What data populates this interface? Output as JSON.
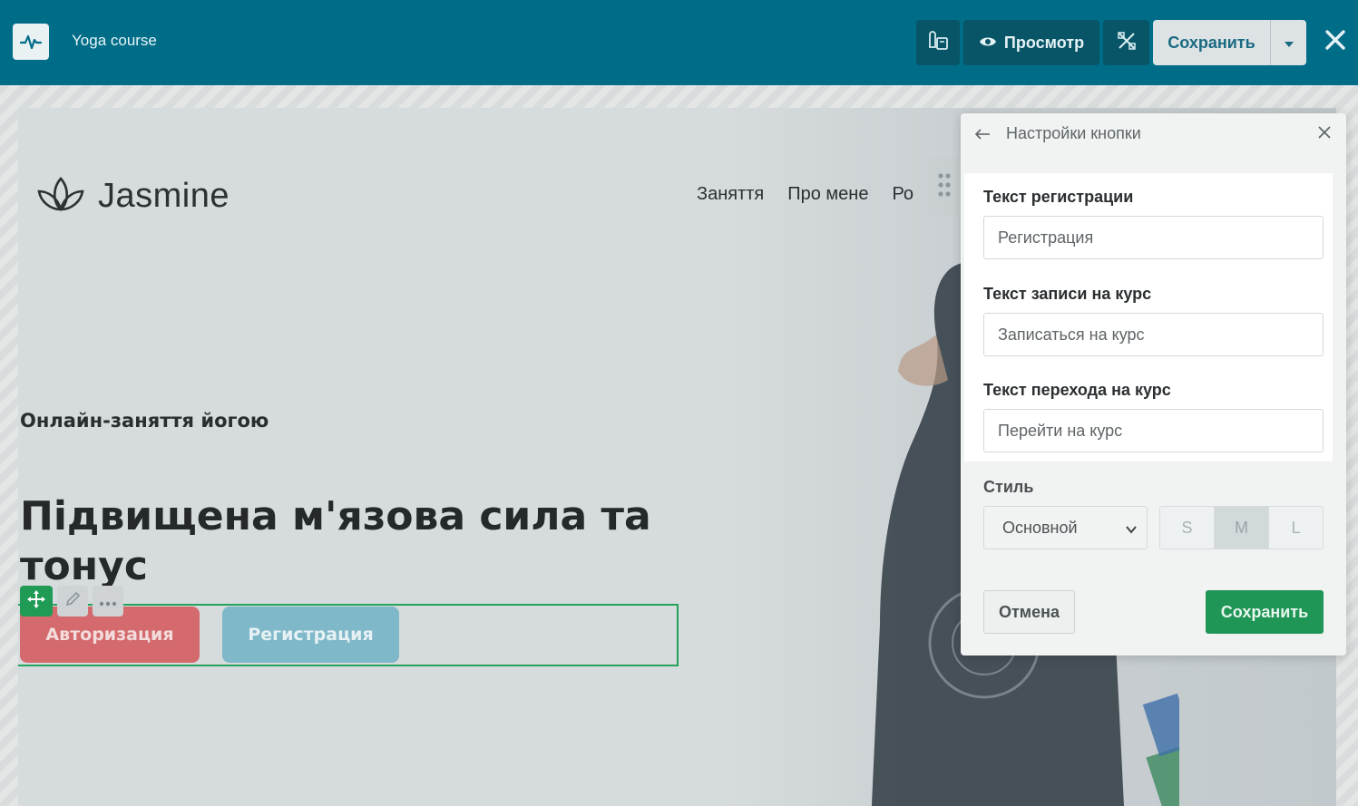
{
  "topbar": {
    "app_title": "Yoga course",
    "preview_label": "Просмотр",
    "save_label": "Сохранить"
  },
  "site": {
    "brand": "Jasmine",
    "nav": [
      "Заняття",
      "Про мене",
      "Ро"
    ],
    "subtitle": "Онлайн-заняття йогою",
    "headline": "Підвищена м'язова сила та тонус",
    "auth_button": "Авторизация",
    "register_button": "Регистрация"
  },
  "panel": {
    "title": "Настройки кнопки",
    "fields": [
      {
        "label": "Текст регистрации",
        "placeholder": "Регистрация"
      },
      {
        "label": "Текст записи на курс",
        "placeholder": "Записаться на курс"
      },
      {
        "label": "Текст перехода на курс",
        "placeholder": "Перейти на курс"
      }
    ],
    "style_label": "Стиль",
    "style_value": "Основной",
    "sizes": [
      "S",
      "M",
      "L"
    ],
    "active_size": "M",
    "cancel_label": "Отмена",
    "save_label": "Сохранить"
  },
  "colors": {
    "toolbar": "#006d88",
    "accent_green": "#1f9556",
    "auth_red": "#d46a6d",
    "register_teal": "#7fb8c8"
  },
  "icons": [
    "pulse-logo-icon",
    "theme-icon",
    "eye-icon",
    "design-tools-icon",
    "chevron-down-icon",
    "close-icon",
    "lotus-logo-icon",
    "drag-dots-icon",
    "move-icon",
    "pencil-icon",
    "more-dots-icon",
    "back-arrow-icon"
  ]
}
